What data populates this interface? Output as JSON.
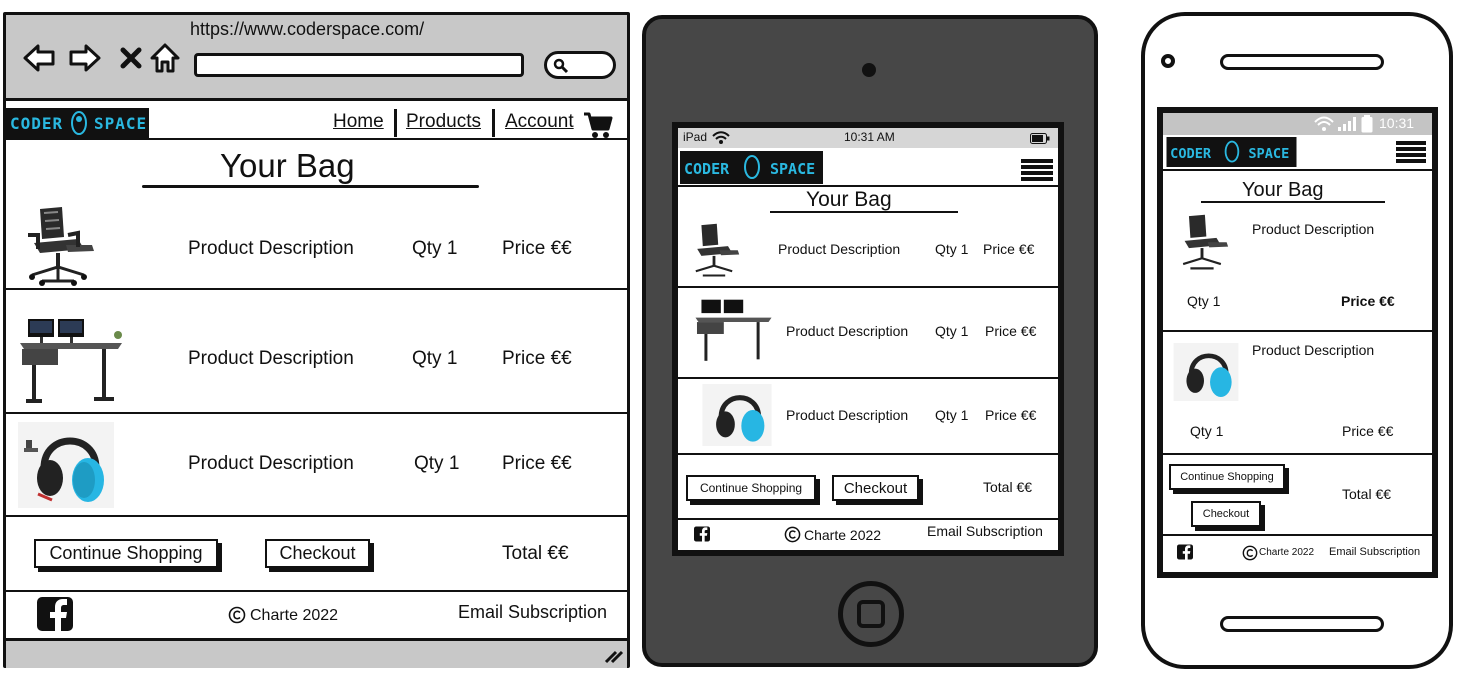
{
  "desktop": {
    "url": "https://www.coderspace.com/",
    "logo_text": "CODER SPACE",
    "nav": {
      "home": "Home",
      "products": "Products",
      "account": "Account"
    },
    "title": "Your Bag",
    "items": [
      {
        "image": "gaming-chair",
        "description": "Product Description",
        "qty": "Qty 1",
        "price": "Price €€"
      },
      {
        "image": "gaming-desk",
        "description": "Product Description",
        "qty": "Qty 1",
        "price": "Price €€"
      },
      {
        "image": "headphones",
        "description": "Product Description",
        "qty": "Qty 1",
        "price": "Price €€"
      }
    ],
    "continue_label": "Continue Shopping",
    "checkout_label": "Checkout",
    "total": "Total €€",
    "copyright": "Charte 2022",
    "email_sub": "Email Subscription"
  },
  "tablet": {
    "status": {
      "device": "iPad",
      "time": "10:31 AM"
    },
    "logo_text": "CODER SPACE",
    "title": "Your Bag",
    "items": [
      {
        "image": "gaming-chair",
        "description": "Product Description",
        "qty": "Qty 1",
        "price": "Price €€"
      },
      {
        "image": "gaming-desk",
        "description": "Product Description",
        "qty": "Qty 1",
        "price": "Price €€"
      },
      {
        "image": "headphones",
        "description": "Product Description",
        "qty": "Qty 1",
        "price": "Price €€"
      }
    ],
    "continue_label": "Continue Shopping",
    "checkout_label": "Checkout",
    "total": "Total €€",
    "copyright": "Charte 2022",
    "email_sub": "Email Subscription"
  },
  "phone": {
    "status": {
      "time": "10:31"
    },
    "logo_text": "CODER SPACE",
    "title": "Your Bag",
    "items": [
      {
        "image": "gaming-chair",
        "description": "Product Description",
        "qty": "Qty 1",
        "price": "Price €€"
      },
      {
        "image": "headphones",
        "description": "Product Description",
        "qty": "Qty 1",
        "price": "Price €€"
      }
    ],
    "continue_label": "Continue Shopping",
    "checkout_label": "Checkout",
    "total": "Total €€",
    "copyright": "Charte 2022",
    "email_sub": "Email Subscription"
  },
  "colors": {
    "logo_bg": "#111111",
    "logo_text": "#2ab8e0",
    "chrome": "#c8c8c8",
    "tablet_body": "#474747",
    "headphone_cyan": "#27b6e3"
  },
  "icons": [
    "back-arrow-icon",
    "forward-arrow-icon",
    "close-icon",
    "home-icon",
    "search-icon",
    "cart-icon",
    "facebook-icon",
    "copyright-icon",
    "wifi-icon",
    "battery-icon",
    "signal-icon",
    "hamburger-menu-icon",
    "camera-icon",
    "home-button-icon"
  ]
}
